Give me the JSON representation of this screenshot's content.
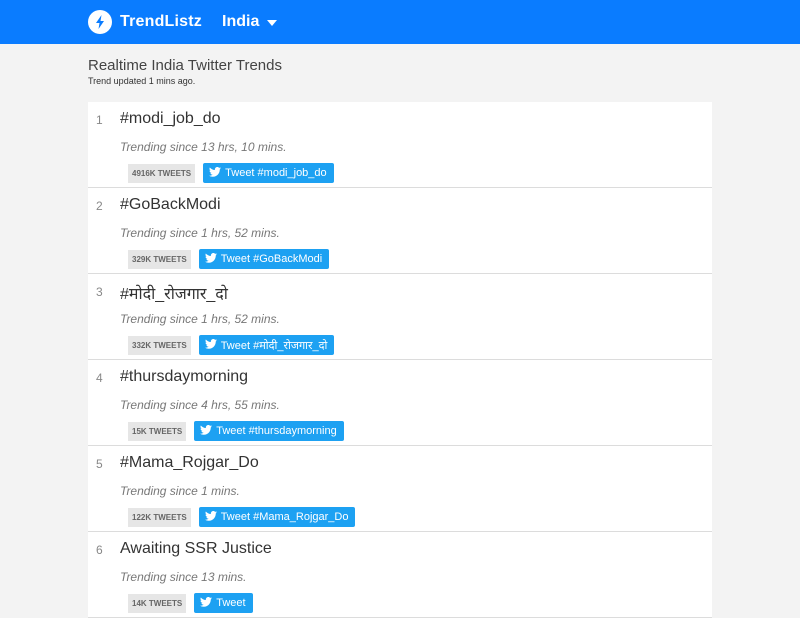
{
  "navbar": {
    "brand": "TrendListz",
    "country": "India",
    "accent": "#0a7cff",
    "logo_icon": "lightning-bolt-icon",
    "caret_icon": "caret-down-icon"
  },
  "header": {
    "title": "Realtime India Twitter Trends",
    "updated": "Trend updated 1 mins ago."
  },
  "trends": [
    {
      "rank": "1",
      "name": "#modi_job_do",
      "since": "Trending since 13 hrs, 10 mins.",
      "tweets": "4916K TWEETS",
      "tweet_label": "Tweet #modi_job_do"
    },
    {
      "rank": "2",
      "name": "#GoBackModi",
      "since": "Trending since 1 hrs, 52 mins.",
      "tweets": "329K TWEETS",
      "tweet_label": "Tweet #GoBackModi"
    },
    {
      "rank": "3",
      "name": "#मोदी_रोजगार_दो",
      "since": "Trending since 1 hrs, 52 mins.",
      "tweets": "332K TWEETS",
      "tweet_label": "Tweet #मोदी_रोजगार_दो"
    },
    {
      "rank": "4",
      "name": "#thursdaymorning",
      "since": "Trending since 4 hrs, 55 mins.",
      "tweets": "15K TWEETS",
      "tweet_label": "Tweet #thursdaymorning"
    },
    {
      "rank": "5",
      "name": "#Mama_Rojgar_Do",
      "since": "Trending since 1 mins.",
      "tweets": "122K TWEETS",
      "tweet_label": "Tweet #Mama_Rojgar_Do"
    },
    {
      "rank": "6",
      "name": "Awaiting SSR Justice",
      "since": "Trending since 13 mins.",
      "tweets": "14K TWEETS",
      "tweet_label": "Tweet"
    }
  ],
  "colors": {
    "tweet_button": "#1da1f2",
    "count_badge": "#e6e6e6"
  }
}
